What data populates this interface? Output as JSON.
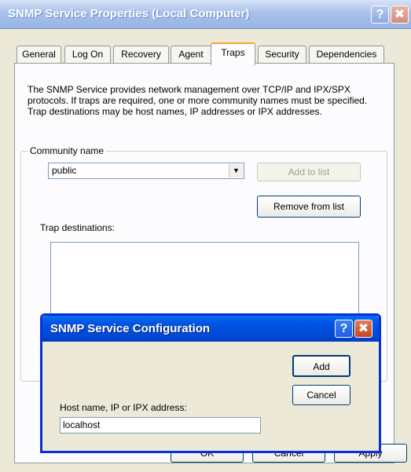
{
  "main_window": {
    "title": "SNMP Service Properties (Local Computer)",
    "help_button": "?",
    "close_button": "✖",
    "tabs": [
      {
        "label": "General",
        "active": false
      },
      {
        "label": "Log On",
        "active": false
      },
      {
        "label": "Recovery",
        "active": false
      },
      {
        "label": "Agent",
        "active": false
      },
      {
        "label": "Traps",
        "active": true
      },
      {
        "label": "Security",
        "active": false
      },
      {
        "label": "Dependencies",
        "active": false
      }
    ],
    "description": "The SNMP Service provides network management over TCP/IP and IPX/SPX protocols. If traps are required, one or more community names must be specified. Trap destinations may be host names, IP addresses or IPX addresses.",
    "community": {
      "group_label": "Community name",
      "selected_value": "public",
      "dropdown_icon": "▼",
      "add_to_list_label": "Add to list",
      "remove_from_list_label": "Remove from list"
    },
    "trap_destinations_label": "Trap destinations:",
    "buttons": {
      "ok": "OK",
      "cancel": "Cancel",
      "apply": "Apply"
    }
  },
  "dialog": {
    "title": "SNMP Service Configuration",
    "help_button": "?",
    "close_button": "✖",
    "add_label": "Add",
    "cancel_label": "Cancel",
    "host_label": "Host name, IP or IPX address:",
    "host_value": "localhost"
  }
}
